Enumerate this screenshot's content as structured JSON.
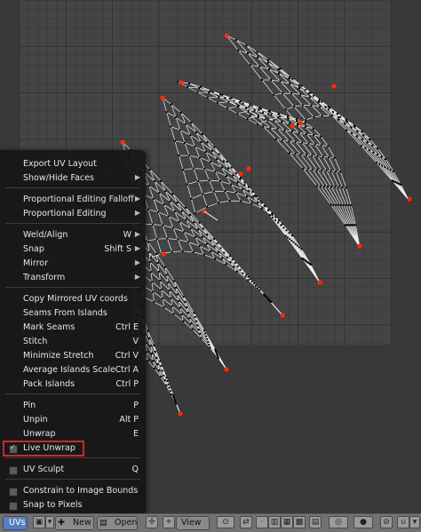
{
  "menu": {
    "items": [
      {
        "label": "Export UV Layout",
        "shortcut": "",
        "submenu": false
      },
      {
        "label": "Show/Hide Faces",
        "shortcut": "",
        "submenu": true
      },
      {
        "label": "Proportional Editing Falloff",
        "shortcut": "",
        "submenu": true
      },
      {
        "label": "Proportional Editing",
        "shortcut": "",
        "submenu": true
      },
      {
        "label": "Weld/Align",
        "shortcut": "W",
        "submenu": true
      },
      {
        "label": "Snap",
        "shortcut": "Shift S",
        "submenu": true
      },
      {
        "label": "Mirror",
        "shortcut": "",
        "submenu": true
      },
      {
        "label": "Transform",
        "shortcut": "",
        "submenu": true
      },
      {
        "label": "Copy Mirrored UV coords",
        "shortcut": "",
        "submenu": false
      },
      {
        "label": "Seams From Islands",
        "shortcut": "",
        "submenu": false
      },
      {
        "label": "Mark Seams",
        "shortcut": "Ctrl E",
        "submenu": false
      },
      {
        "label": "Stitch",
        "shortcut": "V",
        "submenu": false
      },
      {
        "label": "Minimize Stretch",
        "shortcut": "Ctrl V",
        "submenu": false
      },
      {
        "label": "Average Islands Scale",
        "shortcut": "Ctrl A",
        "submenu": false
      },
      {
        "label": "Pack Islands",
        "shortcut": "Ctrl P",
        "submenu": false
      },
      {
        "label": "Pin",
        "shortcut": "P",
        "submenu": false
      },
      {
        "label": "Unpin",
        "shortcut": "Alt P",
        "submenu": false
      },
      {
        "label": "Unwrap",
        "shortcut": "E",
        "submenu": false
      },
      {
        "label": "Live Unwrap",
        "shortcut": "",
        "checkbox": true,
        "checked": true
      },
      {
        "label": "UV Sculpt",
        "shortcut": "Q",
        "checkbox": true,
        "checked": false
      },
      {
        "label": "Constrain to Image Bounds",
        "shortcut": "",
        "checkbox": true,
        "checked": false
      },
      {
        "label": "Snap to Pixels",
        "shortcut": "",
        "checkbox": true,
        "checked": false
      }
    ],
    "highlighted": "Live Unwrap"
  },
  "bottom_bar": {
    "uvs_label": "UVs",
    "new_label": "New",
    "open_label": "Open",
    "view_label": "View"
  },
  "colors": {
    "uv_edge": "#ffffff",
    "uv_vertex": "#000000",
    "selected_vertex": "#ff2a00",
    "highlight_box": "#e02020",
    "grid_bg": "#444444"
  },
  "icons": [
    "image-editor-icon",
    "image-browse-icon",
    "plus-icon",
    "folder-icon",
    "cursor-icon",
    "pivot-icon",
    "view-icon",
    "sync-selection-icon",
    "select-mode-vertex-icon",
    "select-mode-edge-icon",
    "select-mode-face-icon",
    "select-mode-island-icon",
    "sticky-selection-icon",
    "proportional-icon",
    "snap-icon",
    "magnet-icon"
  ]
}
